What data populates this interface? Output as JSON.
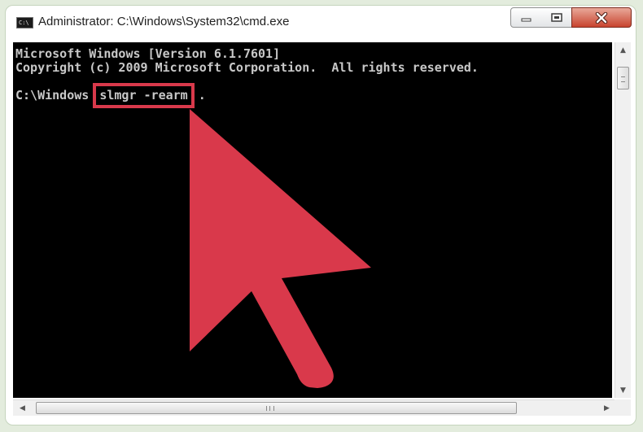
{
  "window": {
    "title": "Administrator: C:\\Windows\\System32\\cmd.exe",
    "icon": "cmd-app-icon",
    "icon_text": "C:\\"
  },
  "console": {
    "lines": [
      "Microsoft Windows [Version 6.1.7601]",
      "Copyright (c) 2009 Microsoft Corporation.  All rights reserved."
    ],
    "prompt": "C:\\Windows",
    "command": "slmgr -rearm",
    "cursor": ".",
    "text_color": "#c8c8c8",
    "background_color": "#000000"
  },
  "annotation": {
    "highlight_color": "#d9394b",
    "arrow_color": "#d9394b",
    "arrow_icon": "pointer-arrow-icon"
  }
}
